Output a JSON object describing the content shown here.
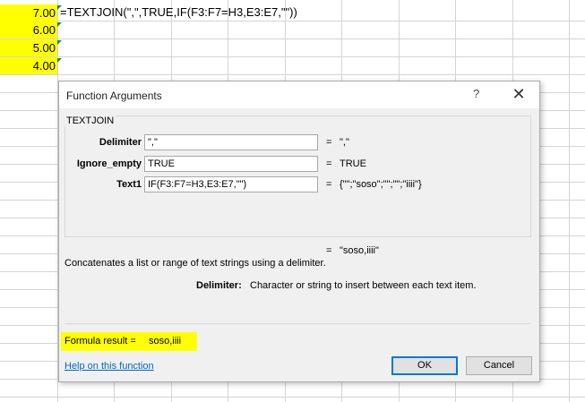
{
  "sheet": {
    "values": [
      "7.00",
      "6.00",
      "5.00",
      "4.00"
    ],
    "formula_text": "=TEXTJOIN(\",\",TRUE,IF(F3:F7=H3,E3:E7,\"\"))"
  },
  "dialog": {
    "title": "Function Arguments",
    "help_glyph": "?",
    "close_glyph": "✕",
    "function_name": "TEXTJOIN",
    "args": [
      {
        "label": "Delimiter",
        "input": "\",\"",
        "result": "\",\""
      },
      {
        "label": "Ignore_empty",
        "input": "TRUE",
        "result": "TRUE"
      },
      {
        "label": "Text1",
        "input": "IF(F3:F7=H3,E3:E7,\"\")",
        "result": "{\"\";\"soso\";\"\";\"\";\"iiii\"}"
      }
    ],
    "equals": "=",
    "ref_glyph": "🡅",
    "overall_result": "\"soso,iiii\"",
    "description": "Concatenates a list or range of text strings using a delimiter.",
    "param_name": "Delimiter:",
    "param_description": "Character or string to insert between each text item.",
    "formula_result_label": "Formula result =",
    "formula_result_value": "soso,iiii",
    "help_link": "Help on this function",
    "ok_label": "OK",
    "cancel_label": "Cancel"
  },
  "colors": {
    "highlight": "#ffff00",
    "link": "#0066cc",
    "ok_border": "#0078d7"
  }
}
